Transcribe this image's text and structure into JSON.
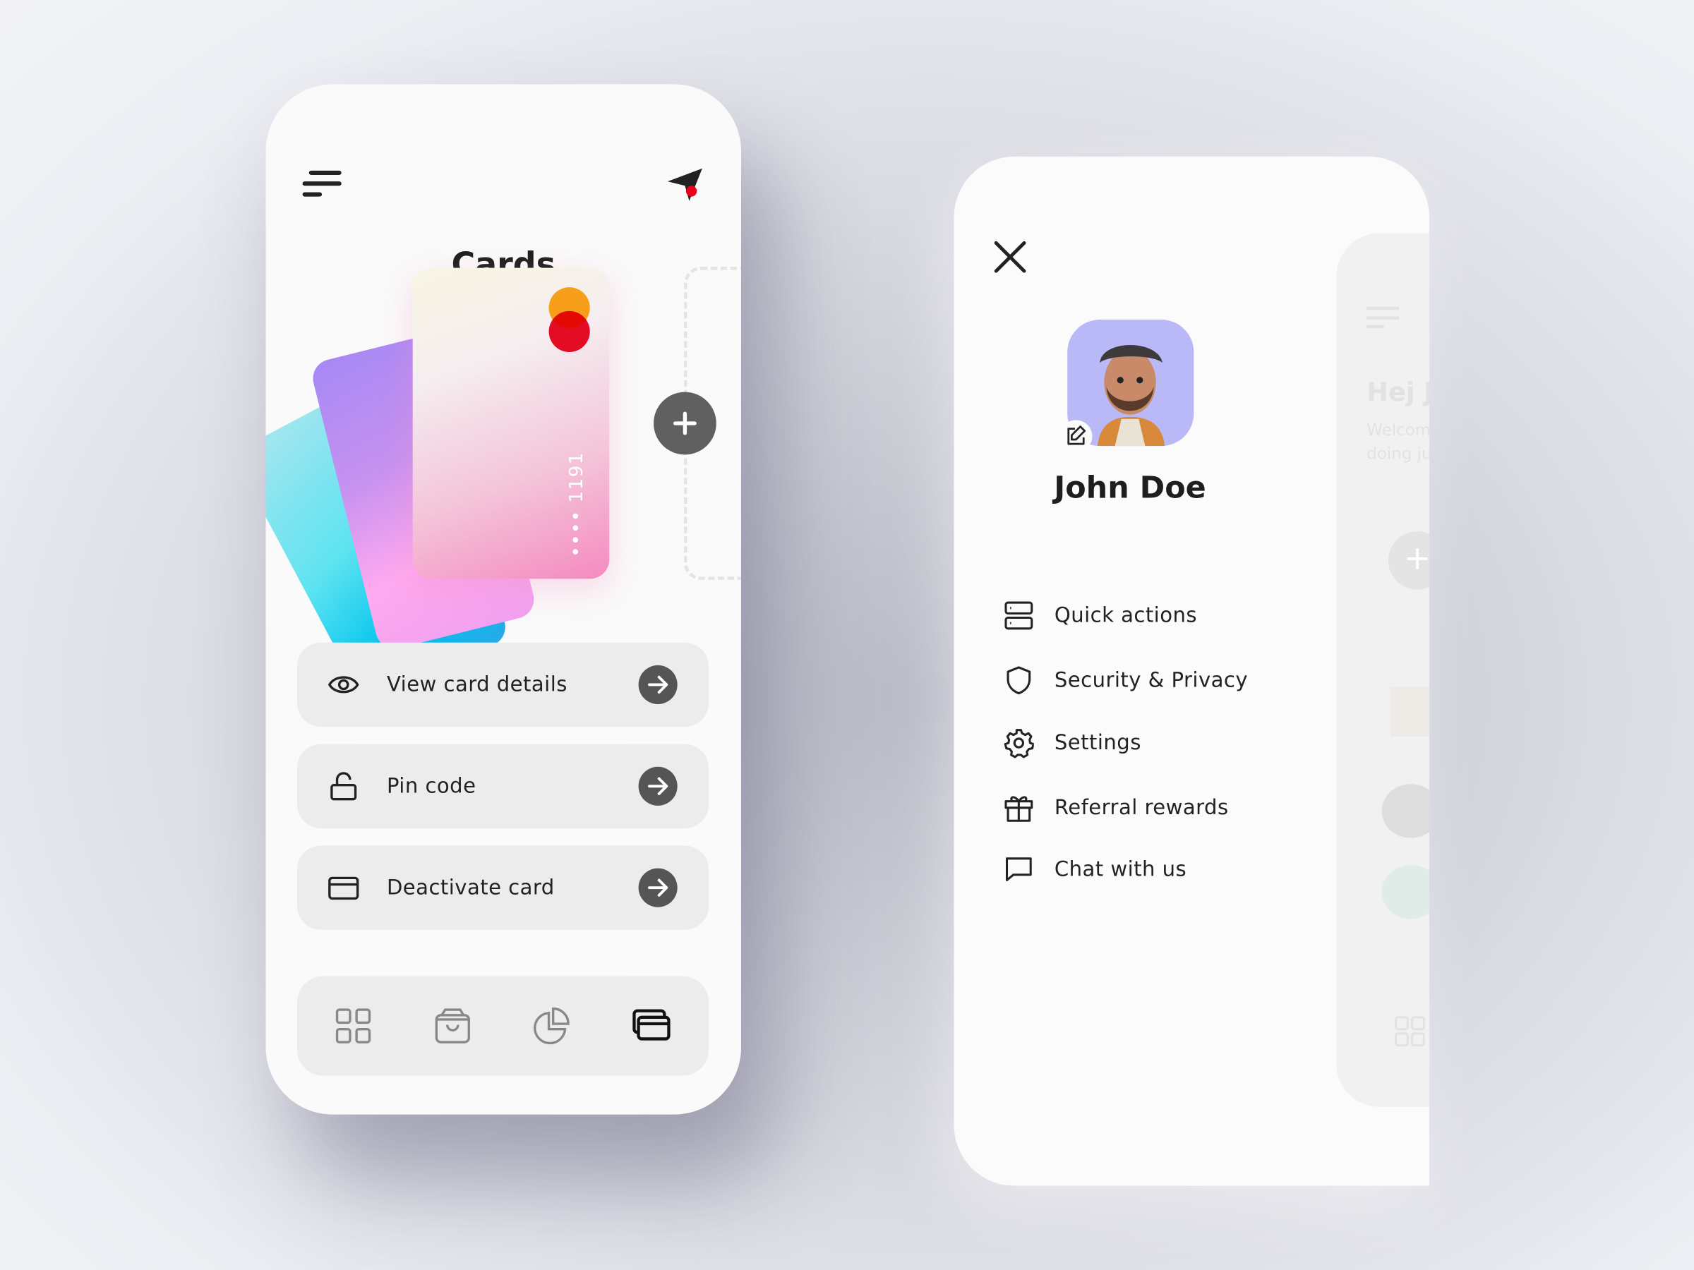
{
  "cards_screen": {
    "title": "Cards",
    "card_number": "•••• 1191",
    "actions": [
      {
        "label": "View card details",
        "icon": "eye-icon"
      },
      {
        "label": "Pin code",
        "icon": "unlock-icon"
      },
      {
        "label": "Deactivate card",
        "icon": "credit-card-icon"
      }
    ],
    "nav": [
      "grid-icon",
      "shopping-bag-icon",
      "pie-chart-icon",
      "cards-icon"
    ],
    "colors": {
      "fab": "#606060",
      "mastercard_orange": "#f79e1b",
      "mastercard_red": "#eb001b"
    }
  },
  "menu_screen": {
    "user_name": "John Doe",
    "avatar_bg": "#b9b9f8",
    "items": [
      {
        "label": "Quick actions",
        "icon": "server-icon"
      },
      {
        "label": "Security & Privacy",
        "icon": "shield-icon"
      },
      {
        "label": "Settings",
        "icon": "gear-icon"
      },
      {
        "label": "Referral rewards",
        "icon": "gift-icon"
      },
      {
        "label": "Chat with us",
        "icon": "chat-icon"
      }
    ],
    "background_screen": {
      "greeting": "Hej J",
      "line1": "Welcom",
      "line2": "doing ju"
    }
  }
}
